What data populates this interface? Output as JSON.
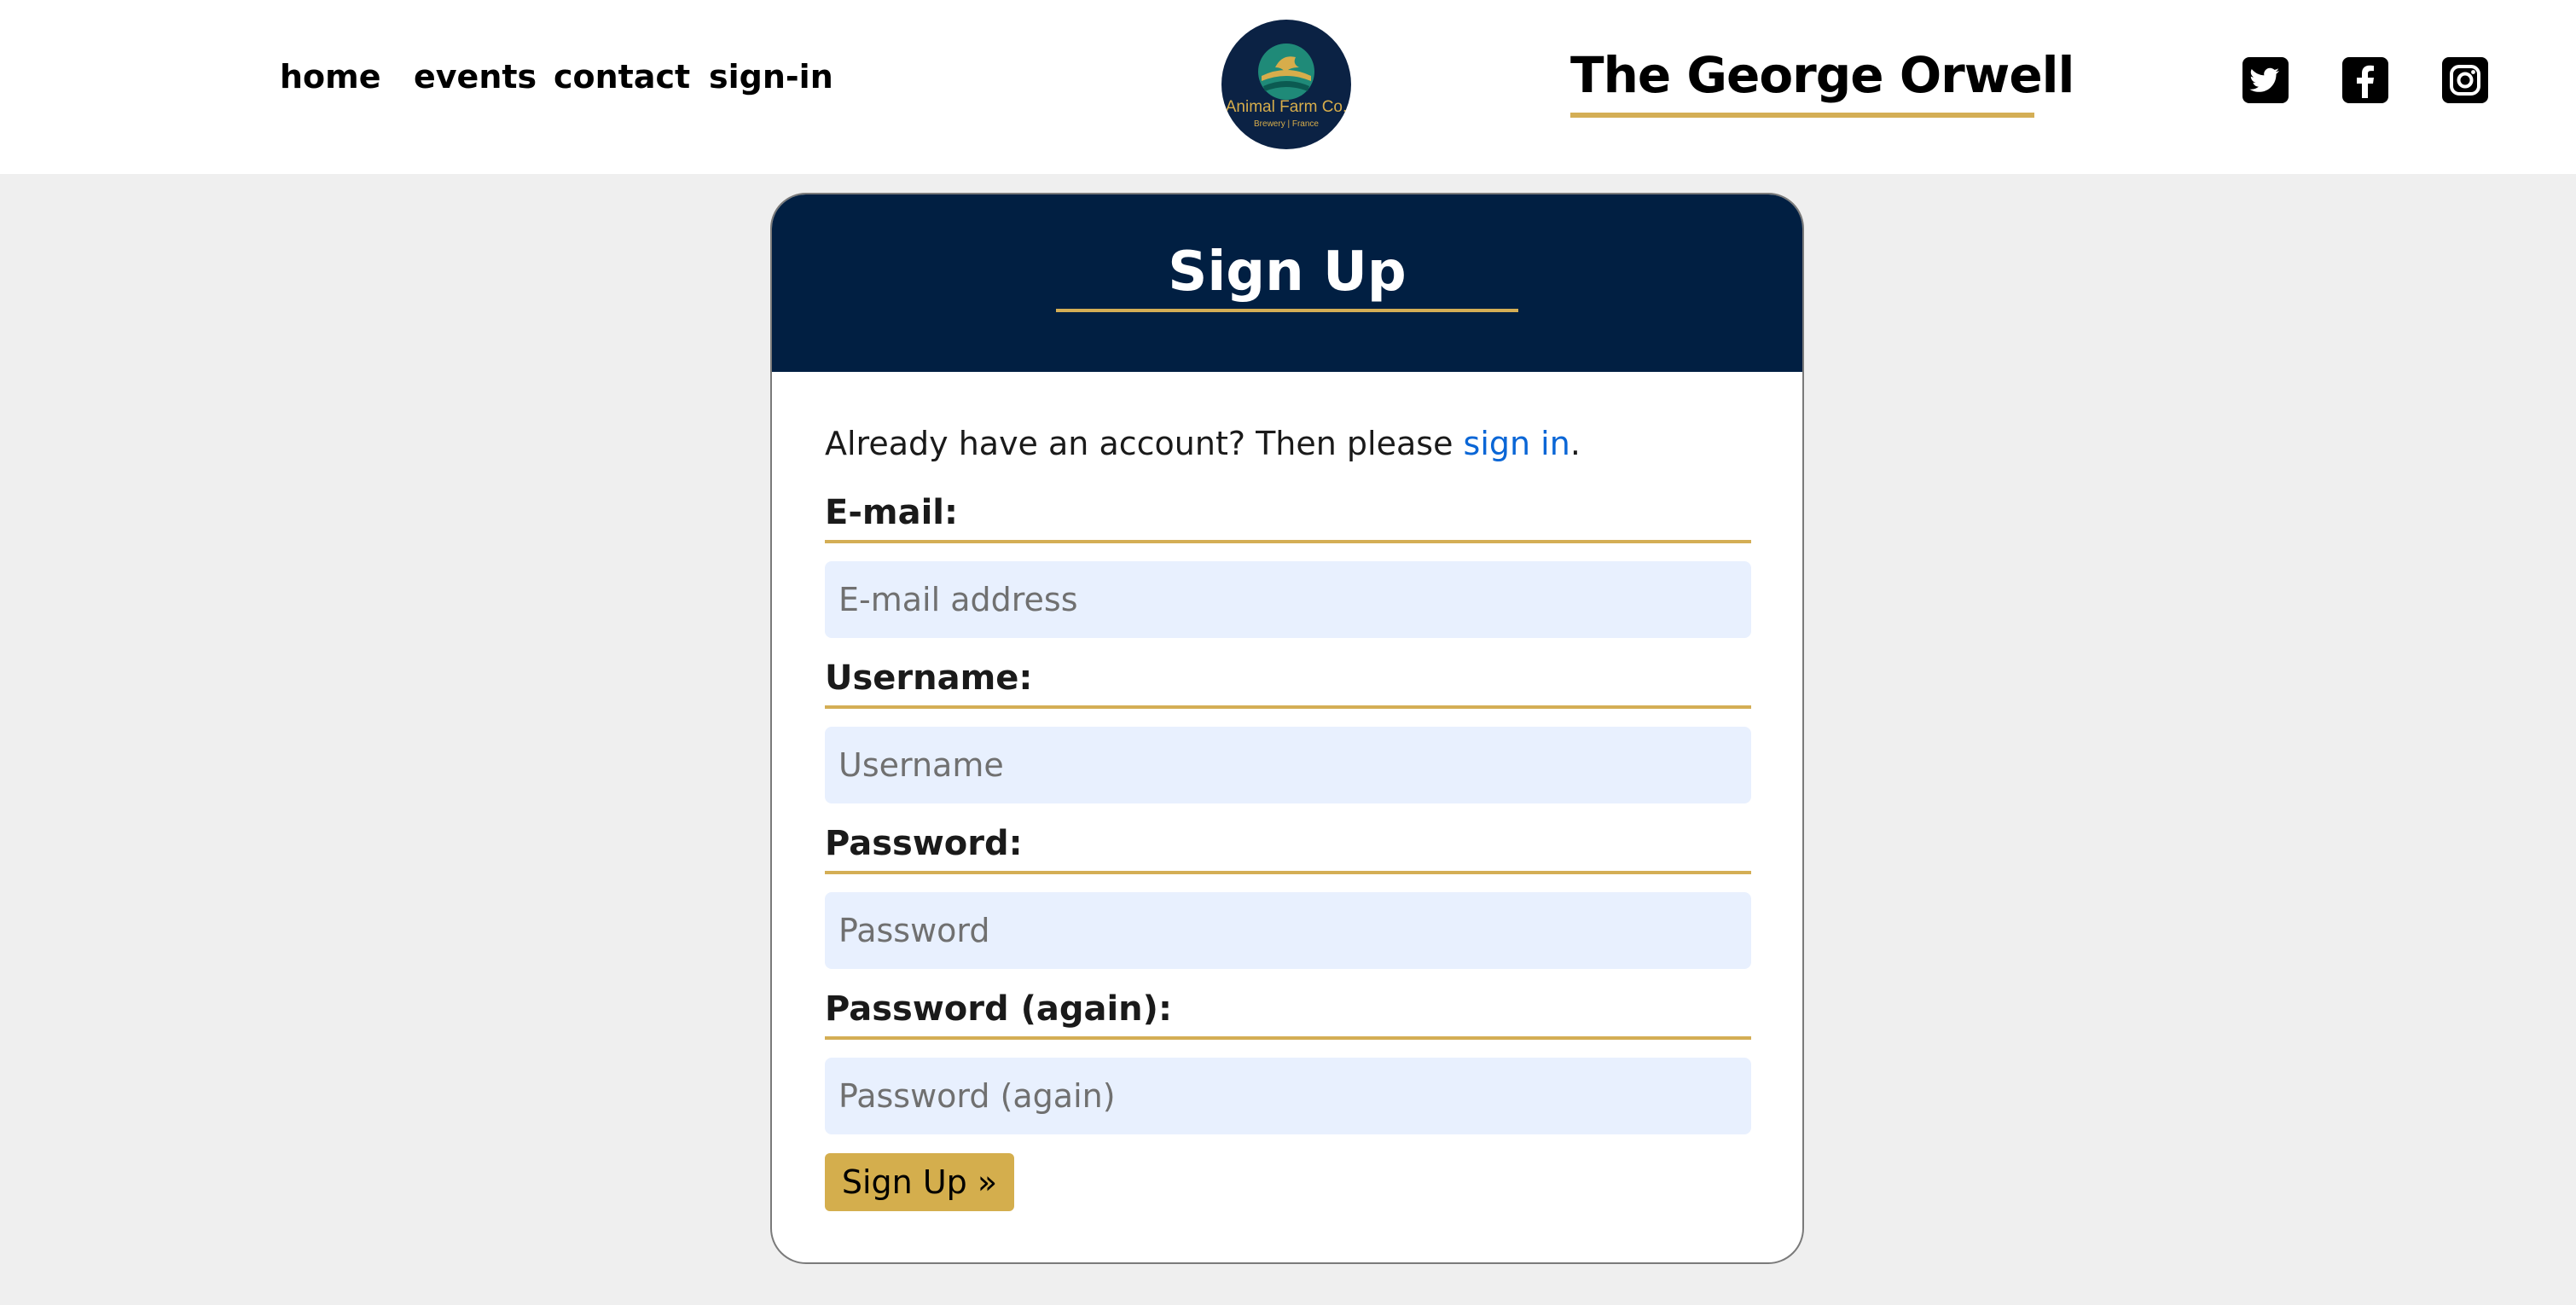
{
  "nav": {
    "home": "home",
    "events": "events",
    "contact": "contact",
    "signin": "sign-in"
  },
  "logo": {
    "brand": "Animal Farm Co.",
    "sub": "Brewery | France"
  },
  "site_title": "The George Orwell",
  "social": [
    "twitter-icon",
    "facebook-icon",
    "instagram-icon"
  ],
  "colors": {
    "navy": "#011f42",
    "gold": "#d4ae55",
    "link": "#0a66d6",
    "input_bg": "#e8f0fe",
    "page_bg": "#efefef"
  },
  "form": {
    "title": "Sign Up",
    "intro_text": "Already have an account? Then please ",
    "intro_link": "sign in",
    "intro_end": ".",
    "email_label": "E-mail:",
    "email_placeholder": "E-mail address",
    "username_label": "Username:",
    "username_placeholder": "Username",
    "password_label": "Password:",
    "password_placeholder": "Password",
    "password2_label": "Password (again):",
    "password2_placeholder": "Password (again)",
    "submit_label": "Sign Up »"
  }
}
